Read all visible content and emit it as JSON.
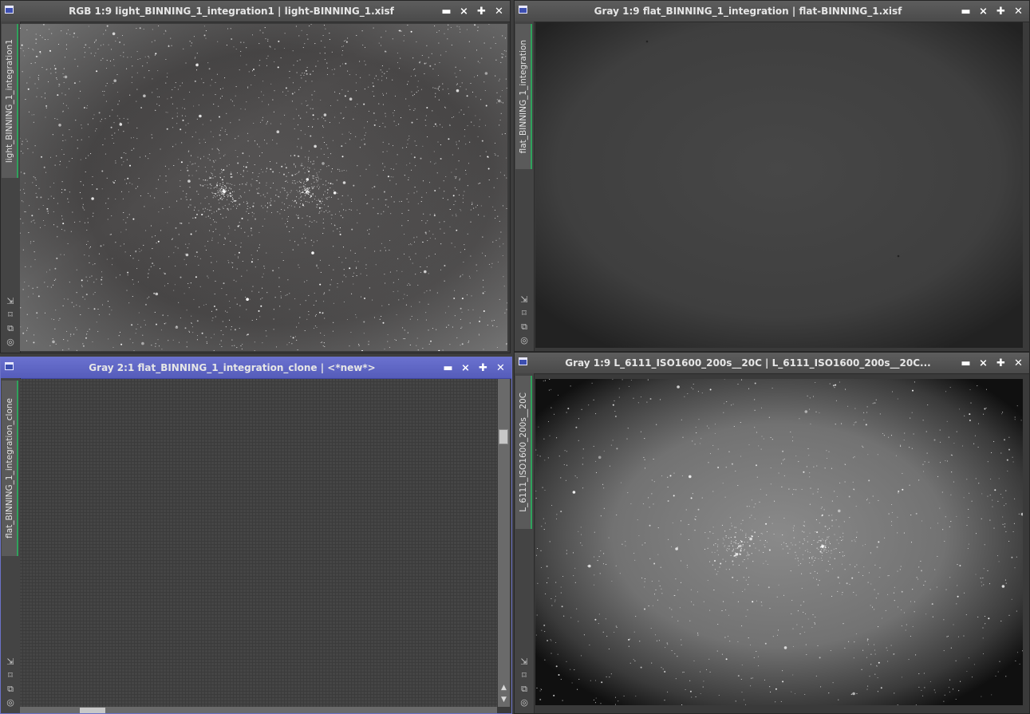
{
  "windows": [
    {
      "id": "light",
      "title": "RGB 1:9 light_BINNING_1_integration1 | light-BINNING_1.xisf",
      "side_tab": "light_BINNING_1_integration1",
      "active": false
    },
    {
      "id": "flat",
      "title": "Gray 1:9 flat_BINNING_1_integration | flat-BINNING_1.xisf",
      "side_tab": "flat_BINNING_1_integration",
      "active": false
    },
    {
      "id": "clone",
      "title": "Gray 2:1 flat_BINNING_1_integration_clone | <*new*>",
      "side_tab": "flat_BINNING_1_integration_clone",
      "active": true
    },
    {
      "id": "L6111",
      "title": "Gray 1:9 L_6111_ISO1600_200s__20C | L_6111_ISO1600_200s__20C...",
      "side_tab": "L_6111_ISO1600_200s__20C",
      "active": false
    }
  ],
  "controls": {
    "minimize": "▬",
    "shade": "⨯",
    "maximize": "✚",
    "close": "✕"
  },
  "side_icon_glyphs": [
    "⇲",
    "⌑",
    "⧉",
    "◎"
  ],
  "icons": [
    "window-system-icon",
    "minimize-icon",
    "shade-icon",
    "maximize-icon",
    "close-icon",
    "fit-view-icon",
    "zoom-icon",
    "clone-icon",
    "stf-icon"
  ],
  "colors": {
    "active_title": "#5a62c4",
    "inactive_title": "#4e4e4e",
    "tab_accent": "#2fa25c",
    "workspace": "#3d3d3d"
  }
}
